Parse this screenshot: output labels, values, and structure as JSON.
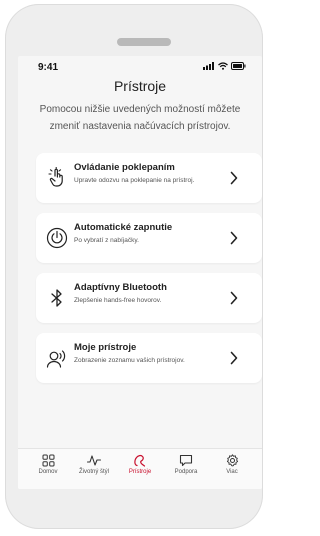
{
  "status": {
    "time": "9:41"
  },
  "page": {
    "title": "Prístroje",
    "intro_line1": "Pomocou nižšie uvedených možností môžete",
    "intro_line2": "zmeniť nastavenia načúvacích prístrojov."
  },
  "cards": [
    {
      "title": "Ovládanie poklepaním",
      "subtitle": "Upravte odozvu na poklepanie na prístroj.",
      "icon": "tap-hand-icon"
    },
    {
      "title": "Automatické zapnutie",
      "subtitle": "Po vybratí z nabíjačky.",
      "icon": "power-icon"
    },
    {
      "title": "Adaptívny Bluetooth",
      "subtitle": "Zlepšenie hands-free hovorov.",
      "icon": "bluetooth-icon"
    },
    {
      "title": "Moje prístroje",
      "subtitle": "Zobrazenie zoznamu vašich prístrojov.",
      "icon": "person-sound-icon"
    }
  ],
  "tabs": [
    {
      "label": "Domov",
      "icon": "grid-icon"
    },
    {
      "label": "Životný štýl",
      "icon": "activity-icon"
    },
    {
      "label": "Prístroje",
      "icon": "hearing-aid-icon",
      "active": true
    },
    {
      "label": "Podpora",
      "icon": "chat-icon"
    },
    {
      "label": "Viac",
      "icon": "gear-icon"
    }
  ],
  "colors": {
    "accent": "#c8102e",
    "background": "#f6f6f6",
    "card": "#ffffff"
  }
}
